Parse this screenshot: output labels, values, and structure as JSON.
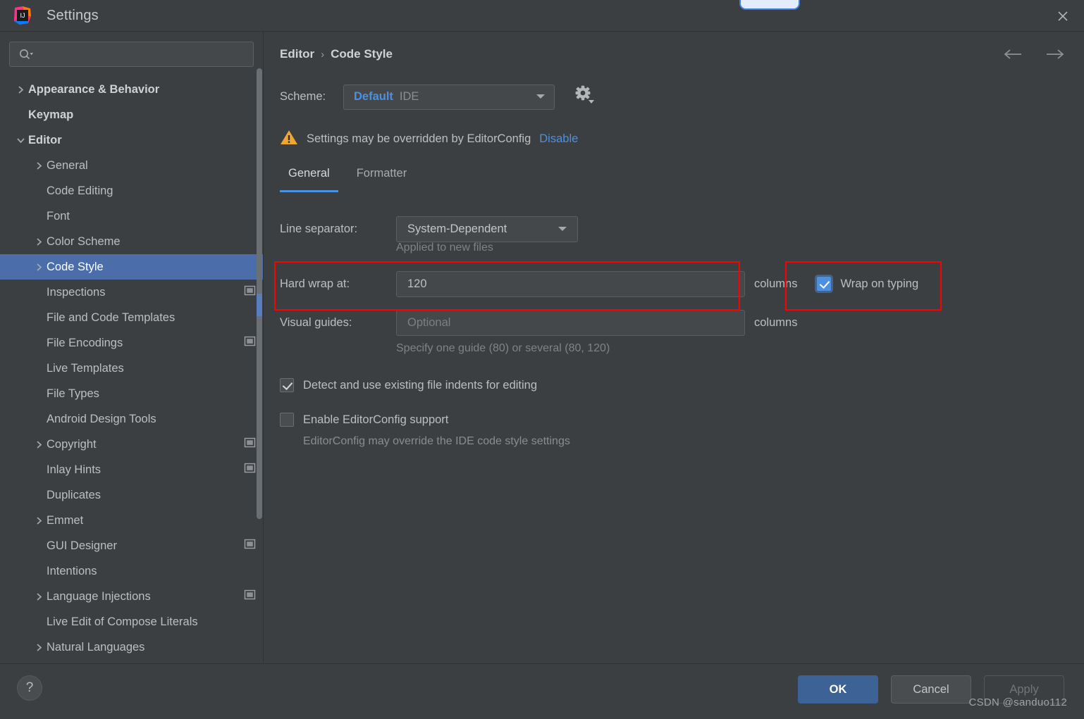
{
  "window": {
    "title": "Settings",
    "app_icon": "intellij-idea-logo",
    "close_icon": "close-icon"
  },
  "search": {
    "placeholder": "",
    "value": "",
    "icon": "search-icon"
  },
  "sidebar": {
    "items": [
      {
        "label": "Appearance & Behavior",
        "level": 1,
        "arrow": "chevron-right",
        "badge": false,
        "selected": false
      },
      {
        "label": "Keymap",
        "level": 1,
        "arrow": "none",
        "badge": false,
        "selected": false
      },
      {
        "label": "Editor",
        "level": 1,
        "arrow": "chevron-down",
        "badge": false,
        "selected": false
      },
      {
        "label": "General",
        "level": 2,
        "arrow": "chevron-right",
        "badge": false,
        "selected": false
      },
      {
        "label": "Code Editing",
        "level": 2,
        "arrow": "none",
        "badge": false,
        "selected": false
      },
      {
        "label": "Font",
        "level": 2,
        "arrow": "none",
        "badge": false,
        "selected": false
      },
      {
        "label": "Color Scheme",
        "level": 2,
        "arrow": "chevron-right",
        "badge": false,
        "selected": false
      },
      {
        "label": "Code Style",
        "level": 2,
        "arrow": "chevron-right",
        "badge": false,
        "selected": true
      },
      {
        "label": "Inspections",
        "level": 2,
        "arrow": "none",
        "badge": true,
        "selected": false
      },
      {
        "label": "File and Code Templates",
        "level": 2,
        "arrow": "none",
        "badge": false,
        "selected": false
      },
      {
        "label": "File Encodings",
        "level": 2,
        "arrow": "none",
        "badge": true,
        "selected": false
      },
      {
        "label": "Live Templates",
        "level": 2,
        "arrow": "none",
        "badge": false,
        "selected": false
      },
      {
        "label": "File Types",
        "level": 2,
        "arrow": "none",
        "badge": false,
        "selected": false
      },
      {
        "label": "Android Design Tools",
        "level": 2,
        "arrow": "none",
        "badge": false,
        "selected": false
      },
      {
        "label": "Copyright",
        "level": 2,
        "arrow": "chevron-right",
        "badge": true,
        "selected": false
      },
      {
        "label": "Inlay Hints",
        "level": 2,
        "arrow": "none",
        "badge": true,
        "selected": false
      },
      {
        "label": "Duplicates",
        "level": 2,
        "arrow": "none",
        "badge": false,
        "selected": false
      },
      {
        "label": "Emmet",
        "level": 2,
        "arrow": "chevron-right",
        "badge": false,
        "selected": false
      },
      {
        "label": "GUI Designer",
        "level": 2,
        "arrow": "none",
        "badge": true,
        "selected": false
      },
      {
        "label": "Intentions",
        "level": 2,
        "arrow": "none",
        "badge": false,
        "selected": false
      },
      {
        "label": "Language Injections",
        "level": 2,
        "arrow": "chevron-right",
        "badge": true,
        "selected": false
      },
      {
        "label": "Live Edit of Compose Literals",
        "level": 2,
        "arrow": "none",
        "badge": false,
        "selected": false
      },
      {
        "label": "Natural Languages",
        "level": 2,
        "arrow": "chevron-right",
        "badge": false,
        "selected": false
      }
    ]
  },
  "main": {
    "breadcrumb": {
      "parent": "Editor",
      "separator": "›",
      "current": "Code Style"
    },
    "nav": {
      "back_icon": "arrow-left-icon",
      "forward_icon": "arrow-right-icon"
    },
    "scheme": {
      "label": "Scheme:",
      "value": "Default",
      "value_suffix": "IDE",
      "gear_icon": "gear-icon",
      "dropdown_icon": "chevron-down-icon"
    },
    "warning": {
      "icon": "warning-triangle-icon",
      "text": "Settings may be overridden by EditorConfig",
      "link": "Disable"
    },
    "tabs": [
      {
        "label": "General",
        "active": true
      },
      {
        "label": "Formatter",
        "active": false
      }
    ],
    "fields": {
      "line_separator": {
        "label": "Line separator:",
        "value": "System-Dependent",
        "hint": "Applied to new files"
      },
      "hard_wrap": {
        "label": "Hard wrap at:",
        "value": "120",
        "unit": "columns"
      },
      "wrap_on_typing": {
        "label": "Wrap on typing",
        "checked": true
      },
      "visual_guides": {
        "label": "Visual guides:",
        "value": "",
        "placeholder": "Optional",
        "unit": "columns",
        "hint": "Specify one guide (80) or several (80, 120)"
      },
      "detect_indents": {
        "label": "Detect and use existing file indents for editing",
        "checked": true
      },
      "enable_editorconfig": {
        "label": "Enable EditorConfig support",
        "checked": false,
        "hint": "EditorConfig may override the IDE code style settings"
      }
    }
  },
  "footer": {
    "help_label": "?",
    "ok_label": "OK",
    "cancel_label": "Cancel",
    "apply_label": "Apply",
    "watermark": "CSDN @sanduo112"
  },
  "colors": {
    "accent_blue": "#4d90e0",
    "selection_blue": "#4b6eaa",
    "primary_button": "#3c6296",
    "warning_amber": "#f0a732",
    "annotation_red": "#ff0000",
    "background": "#3c3f41"
  }
}
